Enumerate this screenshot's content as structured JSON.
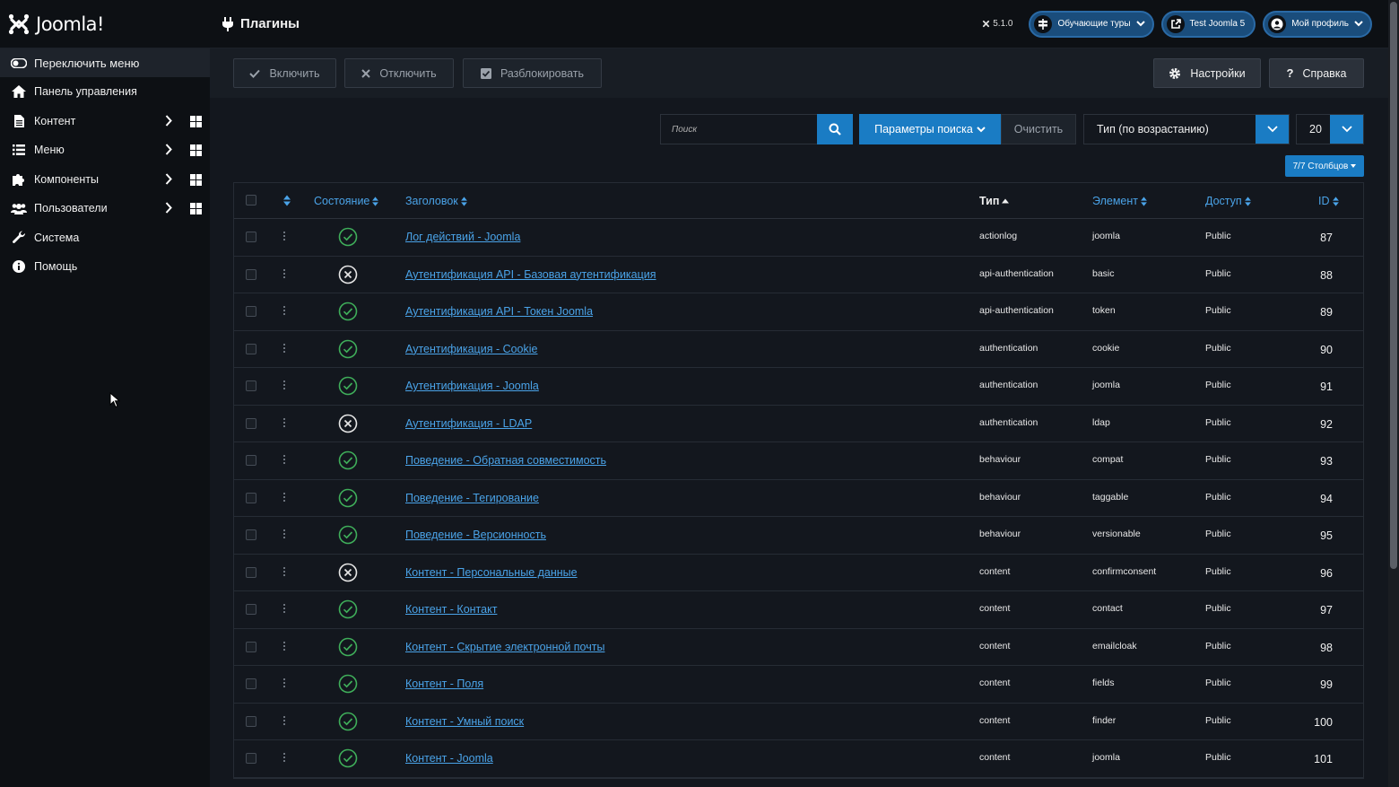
{
  "app": {
    "logo_text": "Joomla!",
    "page_title": "Плагины",
    "version": "5.1.0",
    "header_buttons": [
      {
        "label": "Обучающие туры",
        "icon": "signs-icon"
      },
      {
        "label": "Test Joomla 5",
        "icon": "external-link-icon"
      },
      {
        "label": "Мой профиль",
        "icon": "user-circle-icon"
      }
    ]
  },
  "sidebar": {
    "items": [
      {
        "label": "Переключить меню",
        "icon": "toggle-icon"
      },
      {
        "label": "Панель управления",
        "icon": "home-icon"
      },
      {
        "label": "Контент",
        "icon": "file-icon",
        "submenu": true
      },
      {
        "label": "Меню",
        "icon": "list-icon",
        "submenu": true
      },
      {
        "label": "Компоненты",
        "icon": "puzzle-icon",
        "submenu": true
      },
      {
        "label": "Пользователи",
        "icon": "users-icon",
        "submenu": true
      },
      {
        "label": "Система",
        "icon": "wrench-icon"
      },
      {
        "label": "Помощь",
        "icon": "info-icon"
      }
    ]
  },
  "toolbar": {
    "enable_label": "Включить",
    "disable_label": "Отключить",
    "unlock_label": "Разблокировать",
    "settings_label": "Настройки",
    "help_label": "Справка"
  },
  "filters": {
    "search_placeholder": "Поиск",
    "search_options_label": "Параметры поиска",
    "clear_label": "Очистить",
    "sort_value": "Тип (по возрастанию)",
    "limit_value": "20",
    "columns_label": "7/7 Столбцов"
  },
  "table": {
    "headers": {
      "status": "Состояние",
      "title": "Заголовок",
      "type": "Тип",
      "element": "Элемент",
      "access": "Доступ",
      "id": "ID"
    },
    "rows": [
      {
        "enabled": true,
        "title": "Лог действий - Joomla",
        "type": "actionlog",
        "element": "joomla",
        "access": "Public",
        "id": "87"
      },
      {
        "enabled": false,
        "title": "Аутентификация API - Базовая аутентификация",
        "type": "api-authentication",
        "element": "basic",
        "access": "Public",
        "id": "88"
      },
      {
        "enabled": true,
        "title": "Аутентификация API - Токен Joomla",
        "type": "api-authentication",
        "element": "token",
        "access": "Public",
        "id": "89"
      },
      {
        "enabled": true,
        "title": "Аутентификация - Cookie",
        "type": "authentication",
        "element": "cookie",
        "access": "Public",
        "id": "90"
      },
      {
        "enabled": true,
        "title": "Аутентификация - Joomla",
        "type": "authentication",
        "element": "joomla",
        "access": "Public",
        "id": "91"
      },
      {
        "enabled": false,
        "title": "Аутентификация - LDAP",
        "type": "authentication",
        "element": "ldap",
        "access": "Public",
        "id": "92"
      },
      {
        "enabled": true,
        "title": "Поведение - Обратная совместимость",
        "type": "behaviour",
        "element": "compat",
        "access": "Public",
        "id": "93"
      },
      {
        "enabled": true,
        "title": "Поведение - Тегирование",
        "type": "behaviour",
        "element": "taggable",
        "access": "Public",
        "id": "94"
      },
      {
        "enabled": true,
        "title": "Поведение - Версионность",
        "type": "behaviour",
        "element": "versionable",
        "access": "Public",
        "id": "95"
      },
      {
        "enabled": false,
        "title": "Контент - Персональные данные",
        "type": "content",
        "element": "confirmconsent",
        "access": "Public",
        "id": "96"
      },
      {
        "enabled": true,
        "title": "Контент - Контакт",
        "type": "content",
        "element": "contact",
        "access": "Public",
        "id": "97"
      },
      {
        "enabled": true,
        "title": "Контент - Скрытие электронной почты",
        "type": "content",
        "element": "emailcloak",
        "access": "Public",
        "id": "98"
      },
      {
        "enabled": true,
        "title": "Контент - Поля",
        "type": "content",
        "element": "fields",
        "access": "Public",
        "id": "99"
      },
      {
        "enabled": true,
        "title": "Контент - Умный поиск",
        "type": "content",
        "element": "finder",
        "access": "Public",
        "id": "100"
      },
      {
        "enabled": true,
        "title": "Контент - Joomla",
        "type": "content",
        "element": "joomla",
        "access": "Public",
        "id": "101"
      }
    ]
  },
  "colors": {
    "accent": "#1a7cc4",
    "link": "#4aa3e8",
    "enabled": "#3fae5a",
    "disabled": "#e6e6e6"
  }
}
